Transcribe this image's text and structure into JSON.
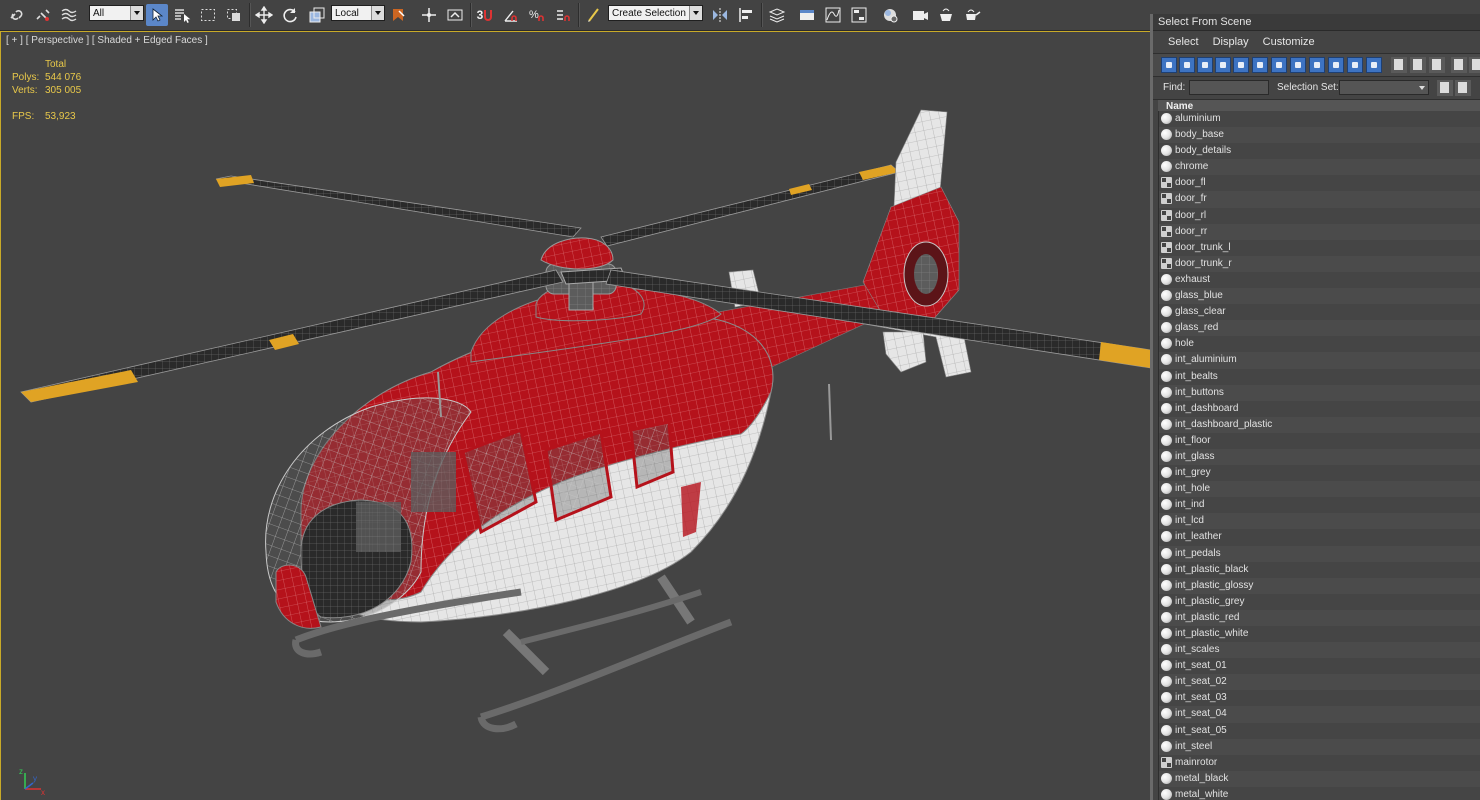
{
  "toolbar": {
    "filter_value": "All",
    "coord_value": "Local",
    "selection_set_value": "Create Selection Se",
    "snap_label": "3",
    "icons": [
      "link-icon",
      "unlink-icon",
      "bind-spacewarp-icon",
      "select-object-icon",
      "select-by-name-icon",
      "rect-region-icon",
      "window-crossing-icon",
      "move-icon",
      "rotate-icon",
      "scale-icon",
      "select-manipulate-icon",
      "pivot-icon",
      "keyboard-shortcut-icon",
      "snap-icon",
      "angle-snap-icon",
      "percent-snap-icon",
      "spinner-snap-icon",
      "edit-named-sel-icon",
      "mirror-icon",
      "align-icon",
      "layer-icon",
      "toggle-ribbon-icon",
      "curve-editor-icon",
      "schematic-icon",
      "material-editor-icon",
      "render-setup-icon",
      "rendered-frame-icon",
      "render-icon"
    ]
  },
  "viewport": {
    "label": "[ + ] [ Perspective ] [ Shaded + Edged Faces ]",
    "stats": {
      "total_label": "Total",
      "polys_label": "Polys:",
      "polys_value": "544 076",
      "verts_label": "Verts:",
      "verts_value": "305 005",
      "fps_label": "FPS:",
      "fps_value": "53,923"
    },
    "axis": {
      "x": "x",
      "y": "y",
      "z": "z"
    }
  },
  "explorer": {
    "title": "Select From Scene",
    "menu": [
      "Select",
      "Display",
      "Customize"
    ],
    "find_label": "Find:",
    "selection_set_label": "Selection Set:",
    "column_header": "Name",
    "items": [
      {
        "name": "aluminium",
        "type": "sphere"
      },
      {
        "name": "body_base",
        "type": "sphere"
      },
      {
        "name": "body_details",
        "type": "sphere"
      },
      {
        "name": "chrome",
        "type": "sphere"
      },
      {
        "name": "door_fl",
        "type": "group"
      },
      {
        "name": "door_fr",
        "type": "group"
      },
      {
        "name": "door_rl",
        "type": "group"
      },
      {
        "name": "door_rr",
        "type": "group"
      },
      {
        "name": "door_trunk_l",
        "type": "group"
      },
      {
        "name": "door_trunk_r",
        "type": "group"
      },
      {
        "name": "exhaust",
        "type": "sphere"
      },
      {
        "name": "glass_blue",
        "type": "sphere"
      },
      {
        "name": "glass_clear",
        "type": "sphere"
      },
      {
        "name": "glass_red",
        "type": "sphere"
      },
      {
        "name": "hole",
        "type": "sphere"
      },
      {
        "name": "int_aluminium",
        "type": "sphere"
      },
      {
        "name": "int_bealts",
        "type": "sphere"
      },
      {
        "name": "int_buttons",
        "type": "sphere"
      },
      {
        "name": "int_dashboard",
        "type": "sphere"
      },
      {
        "name": "int_dashboard_plastic",
        "type": "sphere"
      },
      {
        "name": "int_floor",
        "type": "sphere"
      },
      {
        "name": "int_glass",
        "type": "sphere"
      },
      {
        "name": "int_grey",
        "type": "sphere"
      },
      {
        "name": "int_hole",
        "type": "sphere"
      },
      {
        "name": "int_ind",
        "type": "sphere"
      },
      {
        "name": "int_lcd",
        "type": "sphere"
      },
      {
        "name": "int_leather",
        "type": "sphere"
      },
      {
        "name": "int_pedals",
        "type": "sphere"
      },
      {
        "name": "int_plastic_black",
        "type": "sphere"
      },
      {
        "name": "int_plastic_glossy",
        "type": "sphere"
      },
      {
        "name": "int_plastic_grey",
        "type": "sphere"
      },
      {
        "name": "int_plastic_red",
        "type": "sphere"
      },
      {
        "name": "int_plastic_white",
        "type": "sphere"
      },
      {
        "name": "int_scales",
        "type": "sphere"
      },
      {
        "name": "int_seat_01",
        "type": "sphere"
      },
      {
        "name": "int_seat_02",
        "type": "sphere"
      },
      {
        "name": "int_seat_03",
        "type": "sphere"
      },
      {
        "name": "int_seat_04",
        "type": "sphere"
      },
      {
        "name": "int_seat_05",
        "type": "sphere"
      },
      {
        "name": "int_steel",
        "type": "sphere"
      },
      {
        "name": "mainrotor",
        "type": "group"
      },
      {
        "name": "metal_black",
        "type": "sphere"
      },
      {
        "name": "metal_white",
        "type": "sphere"
      }
    ]
  },
  "colors": {
    "viewport_bg": "#444444",
    "stats_text": "#e8c84a",
    "body_red": "#b5121b",
    "body_white": "#e8e8e8",
    "rotor_tip": "#e0a324",
    "active_viewport_border": "#c8aa28",
    "accent_blue": "#3d73c2"
  }
}
